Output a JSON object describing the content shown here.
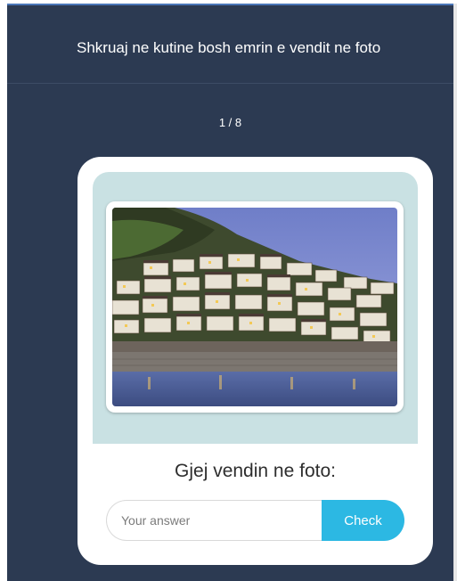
{
  "header": {
    "title": "Shkruaj ne kutine bosh emrin e vendit ne foto"
  },
  "quiz": {
    "counter": "1 / 8",
    "question": "Gjej vendin ne foto:",
    "answer_placeholder": "Your answer",
    "answer_value": "",
    "check_label": "Check"
  },
  "colors": {
    "background": "#2c3a52",
    "accent": "#2cb8e3",
    "image_panel": "#c9e1e3"
  }
}
